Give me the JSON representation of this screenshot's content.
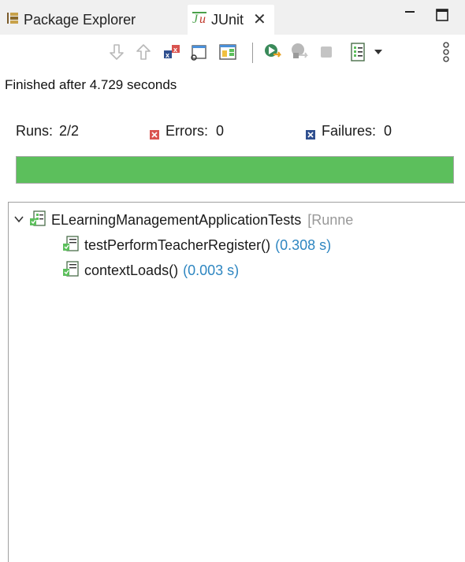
{
  "tabs": [
    {
      "label": "Package Explorer",
      "icon": "package-explorer-icon",
      "active": false
    },
    {
      "label": "JUnit",
      "icon": "junit-icon",
      "active": true
    }
  ],
  "close_glyph": "✕",
  "toolbar": {
    "buttons": [
      {
        "icon": "next-failure-icon",
        "label": "Next Failed Test"
      },
      {
        "icon": "previous-failure-icon",
        "label": "Previous Failed Test"
      },
      {
        "icon": "show-failures-only-icon",
        "label": "Show Failures Only"
      },
      {
        "icon": "scroll-lock-icon",
        "label": "Scroll Lock"
      },
      {
        "icon": "layout-icon",
        "label": "Layout"
      },
      {
        "icon": "rerun-icon",
        "label": "Rerun Test"
      },
      {
        "icon": "rerun-failed-icon",
        "label": "Rerun Test - Failures First"
      },
      {
        "icon": "stop-icon",
        "label": "Stop"
      },
      {
        "icon": "history-icon",
        "label": "Test Run History"
      },
      {
        "icon": "dropdown-icon",
        "label": "History Dropdown"
      },
      {
        "icon": "view-menu-icon",
        "label": "View Menu"
      }
    ]
  },
  "status": {
    "text": "Finished after 4.729 seconds"
  },
  "counters": {
    "runs": {
      "label": "Runs:",
      "value": "2/2"
    },
    "errors": {
      "label": "Errors:",
      "value": "0",
      "color": "#d9534f"
    },
    "failures": {
      "label": "Failures:",
      "value": "0",
      "color": "#2f4f8f"
    }
  },
  "progress": {
    "fraction": 1.0,
    "color": "#5cbf5c"
  },
  "tree": {
    "root": {
      "label": "ELearningManagementApplicationTests",
      "suffix": "[Runne"
    },
    "children": [
      {
        "label": "testPerformTeacherRegister()",
        "time": "(0.308 s)"
      },
      {
        "label": "contextLoads()",
        "time": "(0.003 s)"
      }
    ]
  }
}
